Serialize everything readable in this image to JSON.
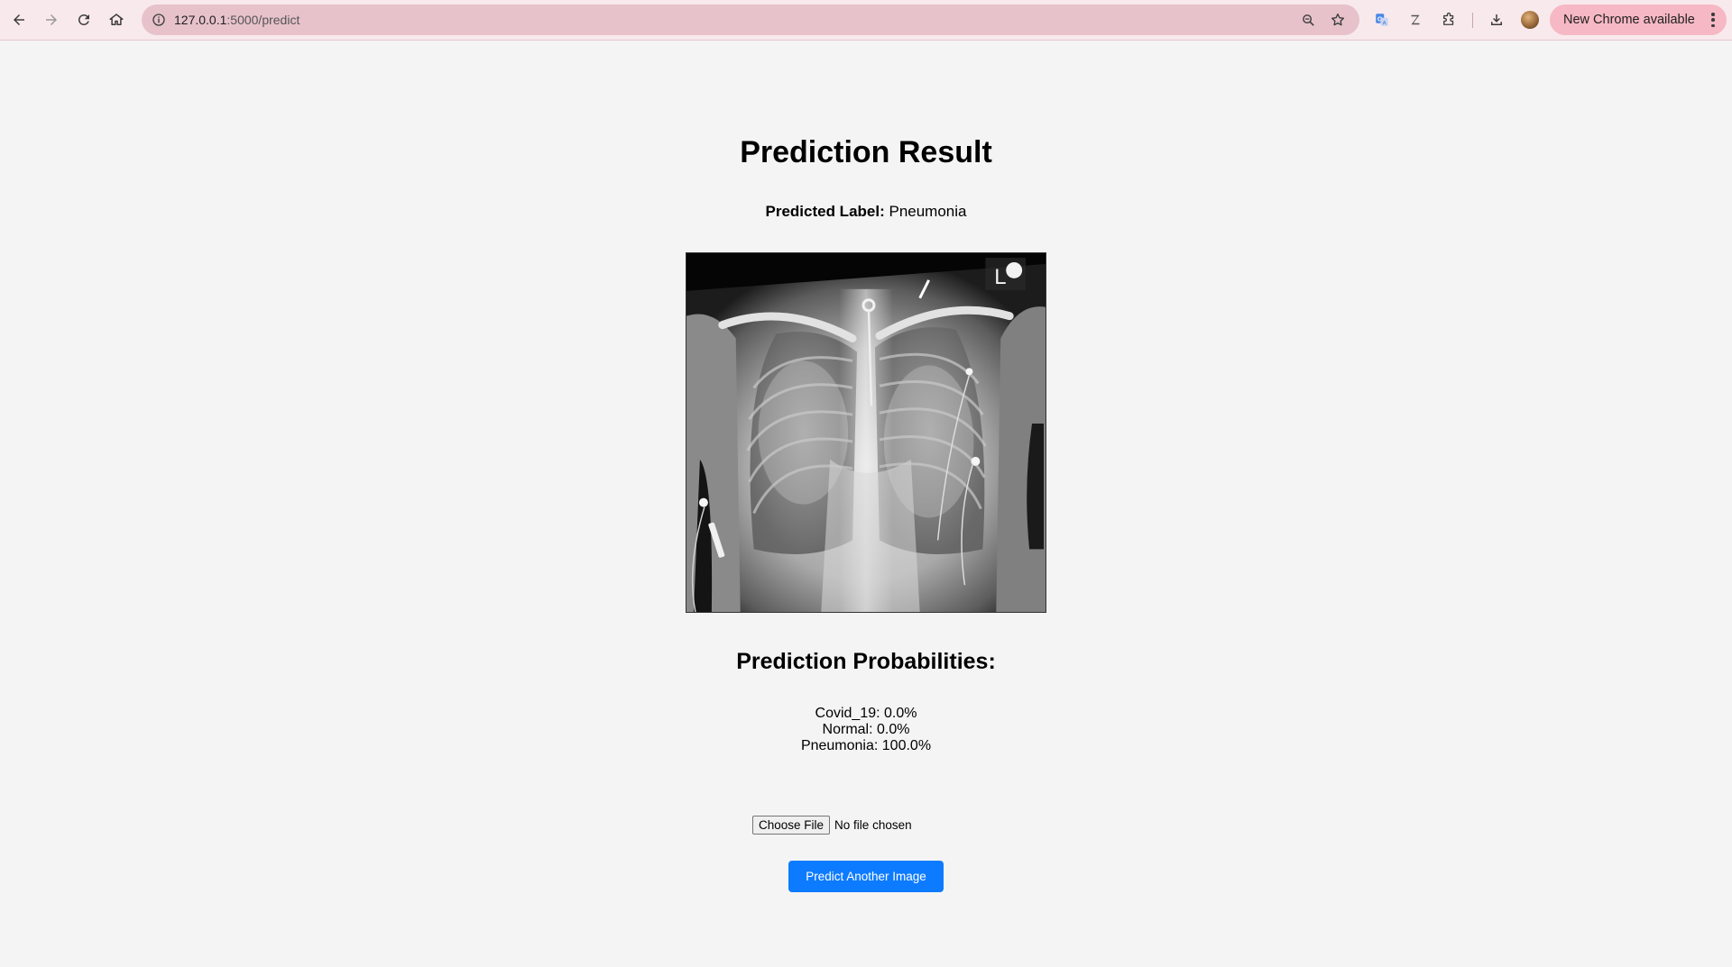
{
  "browser": {
    "url_host": "127.0.0.1",
    "url_path": ":5000/predict",
    "update_button_label": "New Chrome available",
    "icons": [
      "back-arrow-icon",
      "forward-arrow-icon",
      "reload-icon",
      "home-icon",
      "site-info-icon",
      "zoom-icon",
      "bookmark-star-icon",
      "translate-icon",
      "z-extension-icon",
      "extensions-puzzle-icon",
      "download-icon",
      "profile-avatar",
      "more-vert-icon"
    ]
  },
  "page": {
    "title": "Prediction Result",
    "predicted_label_caption": "Predicted Label:",
    "predicted_label_value": "Pneumonia",
    "xray_marker": "L",
    "probabilities_heading": "Prediction Probabilities:",
    "probabilities": [
      "Covid_19: 0.0%",
      "Normal: 0.0%",
      "Pneumonia: 100.0%"
    ],
    "file_input": {
      "button_label": "Choose File",
      "status": "No file chosen"
    },
    "predict_button_label": "Predict Another Image"
  },
  "colors": {
    "toolbar_bg": "#f8e9ec",
    "omnibox_bg": "#e7c2ca",
    "update_chip_bg": "#f6b8c4",
    "page_bg": "#f4f4f4",
    "primary_button": "#0d7bff"
  }
}
